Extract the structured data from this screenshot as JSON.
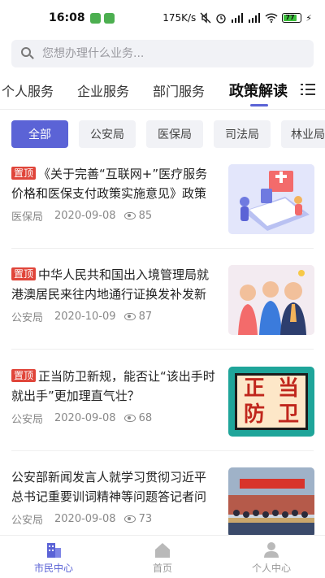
{
  "status_bar": {
    "time": "16:08",
    "network_speed": "175K/s",
    "battery_level": "77",
    "battery_fraction": 0.77
  },
  "search": {
    "placeholder": "您想办理什么业务..."
  },
  "category_tabs": [
    {
      "label": "个人服务",
      "active": false
    },
    {
      "label": "企业服务",
      "active": false
    },
    {
      "label": "部门服务",
      "active": false
    },
    {
      "label": "政策解读",
      "active": true
    }
  ],
  "filter_chips": [
    {
      "label": "全部",
      "active": true
    },
    {
      "label": "公安局",
      "active": false
    },
    {
      "label": "医保局",
      "active": false
    },
    {
      "label": "司法局",
      "active": false
    },
    {
      "label": "林业局",
      "active": false
    }
  ],
  "news": [
    {
      "pinned": true,
      "pin_label": "置顶",
      "title": "《关于完善“互联网+”医疗服务价格和医保支付政策实施意见》政策",
      "department": "医保局",
      "date": "2020-09-08",
      "views": "85"
    },
    {
      "pinned": true,
      "pin_label": "置顶",
      "title": "中华人民共和国出入境管理局就港澳居民来往内地通行证换发补发新",
      "department": "公安局",
      "date": "2020-10-09",
      "views": "87"
    },
    {
      "pinned": true,
      "pin_label": "置顶",
      "title": "正当防卫新规，能否让“该出手时就出手”更加理直气壮？",
      "department": "公安局",
      "date": "2020-09-08",
      "views": "68",
      "thumb_text": [
        "正",
        "当",
        "防",
        "卫"
      ]
    },
    {
      "pinned": false,
      "pin_label": "",
      "title": "公安部新闻发言人就学习贯彻习近平总书记重要训词精神等问题答记者问",
      "department": "公安局",
      "date": "2020-09-08",
      "views": "73"
    }
  ],
  "bottom_tabs": [
    {
      "label": "市民中心",
      "active": true,
      "icon": "building-icon"
    },
    {
      "label": "首页",
      "active": false,
      "icon": "home-icon"
    },
    {
      "label": "个人中心",
      "active": false,
      "icon": "person-icon"
    }
  ],
  "colors": {
    "accent": "#5b63d6",
    "pin": "#e0453a",
    "chip_bg": "#f1f2f6"
  }
}
